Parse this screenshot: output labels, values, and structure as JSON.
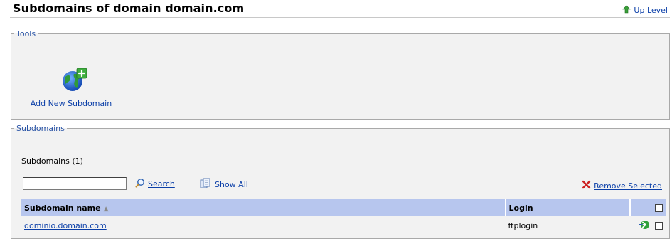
{
  "page": {
    "title": "Subdomains of domain domain.com",
    "up_level": "Up Level"
  },
  "tools": {
    "legend": "Tools",
    "add_new_subdomain": "Add New Subdomain"
  },
  "subdomains": {
    "legend": "Subdomains",
    "count_text": "Subdomains (1)",
    "search": {
      "value": "",
      "search_label": "Search",
      "show_all_label": "Show All"
    },
    "remove_selected": "Remove Selected",
    "columns": {
      "name": "Subdomain name",
      "login": "Login"
    },
    "rows": [
      {
        "name": "dominio.domain.com",
        "login": "ftplogin",
        "selected": false
      }
    ]
  },
  "colors": {
    "header_bg": "#b7c6ee",
    "panel_bg": "#f2f2f2",
    "link": "#0b3fa8",
    "legend": "#2a54a6",
    "up_arrow": "#3aa03a",
    "remove_x": "#cc2222"
  },
  "icons": [
    "up-arrow-icon",
    "globe-plus-icon",
    "magnifier-icon",
    "show-all-icon",
    "remove-x-icon",
    "go-arrow-icon",
    "sort-asc-icon"
  ]
}
